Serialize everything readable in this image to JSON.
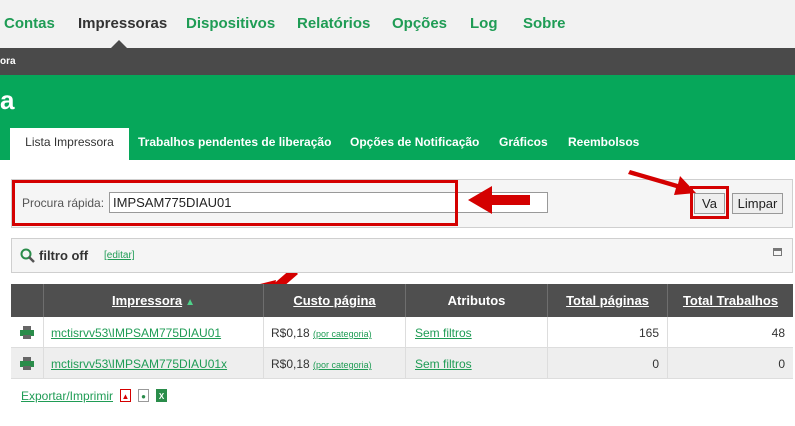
{
  "nav": {
    "items": [
      "Contas",
      "Impressoras",
      "Dispositivos",
      "Relatórios",
      "Opções",
      "Log",
      "Sobre"
    ]
  },
  "breadcrumb": "ora",
  "page_title": "a",
  "tabs": [
    "Lista Impressora",
    "Trabalhos pendentes de liberação",
    "Opções de Notificação",
    "Gráficos",
    "Reembolsos"
  ],
  "search": {
    "label": "Procura rápida:",
    "value": "IMPSAM775DIAU01",
    "go_label": "Va",
    "clear_label": "Limpar"
  },
  "filter": {
    "status": "filtro off",
    "edit_label": "[editar]"
  },
  "table": {
    "columns": [
      "Impressora",
      "Custo página",
      "Atributos",
      "Total páginas",
      "Total Trabalhos"
    ],
    "rows": [
      {
        "printer": "mctisrvv53\\IMPSAM775DIAU01",
        "cost": "R$0,18",
        "cost_link": "(por categoria)",
        "attributes": "Sem filtros",
        "total_pages": "165",
        "total_jobs": "48"
      },
      {
        "printer": "mctisrvv53\\IMPSAM775DIAU01x",
        "cost": "R$0,18",
        "cost_link": "(por categoria)",
        "attributes": "Sem filtros",
        "total_pages": "0",
        "total_jobs": "0"
      }
    ]
  },
  "export": {
    "label": "Exportar/Imprimir",
    "icons": [
      "pdf-icon",
      "html-icon",
      "excel-icon"
    ]
  },
  "colors": {
    "brand_green": "#06a75a",
    "link_green": "#1f9c55",
    "highlight_red": "#d40000",
    "header_dark": "#4f4f4f"
  }
}
